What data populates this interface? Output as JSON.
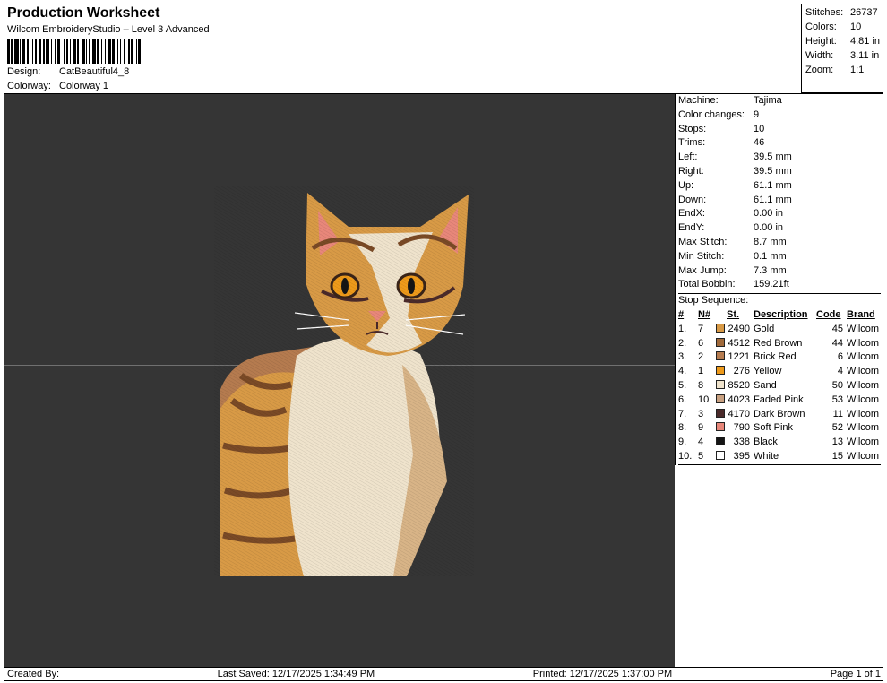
{
  "header": {
    "title": "Production Worksheet",
    "subtitle": "Wilcom EmbroideryStudio – Level 3 Advanced",
    "design_label": "Design:",
    "design_value": "CatBeautiful4_8",
    "colorway_label": "Colorway:",
    "colorway_value": "Colorway 1"
  },
  "stats": [
    {
      "label": "Stitches:",
      "value": "26737"
    },
    {
      "label": "Colors:",
      "value": "10"
    },
    {
      "label": "Height:",
      "value": "4.81 in"
    },
    {
      "label": "Width:",
      "value": "3.11 in"
    },
    {
      "label": "Zoom:",
      "value": "1:1"
    }
  ],
  "machine_info": [
    {
      "label": "Machine:",
      "value": "Tajima"
    },
    {
      "label": "Color changes:",
      "value": "9"
    },
    {
      "label": "Stops:",
      "value": "10"
    },
    {
      "label": "Trims:",
      "value": "46"
    },
    {
      "label": "Left:",
      "value": "39.5 mm"
    },
    {
      "label": "Right:",
      "value": "39.5 mm"
    },
    {
      "label": "Up:",
      "value": "61.1 mm"
    },
    {
      "label": "Down:",
      "value": "61.1 mm"
    },
    {
      "label": "EndX:",
      "value": "0.00 in"
    },
    {
      "label": "EndY:",
      "value": "0.00 in"
    },
    {
      "label": "Max Stitch:",
      "value": "8.7 mm"
    },
    {
      "label": "Min Stitch:",
      "value": "0.1 mm"
    },
    {
      "label": "Max Jump:",
      "value": "7.3 mm"
    },
    {
      "label": "Total Bobbin:",
      "value": "159.21ft"
    }
  ],
  "sequence": {
    "title": "Stop Sequence:",
    "headers": {
      "idx": "#",
      "needle": "N#",
      "st": "St.",
      "desc": "Description",
      "code": "Code",
      "brand": "Brand"
    },
    "rows": [
      {
        "idx": "1.",
        "needle": "7",
        "color": "#D89A46",
        "st": "2490",
        "desc": "Gold",
        "code": "45",
        "brand": "Wilcom"
      },
      {
        "idx": "2.",
        "needle": "6",
        "color": "#A0693A",
        "st": "4512",
        "desc": "Red Brown",
        "code": "44",
        "brand": "Wilcom"
      },
      {
        "idx": "3.",
        "needle": "2",
        "color": "#B57B4F",
        "st": "1221",
        "desc": "Brick Red",
        "code": "6",
        "brand": "Wilcom"
      },
      {
        "idx": "4.",
        "needle": "1",
        "color": "#EE9A1A",
        "st": "276",
        "desc": "Yellow",
        "code": "4",
        "brand": "Wilcom"
      },
      {
        "idx": "5.",
        "needle": "8",
        "color": "#EFE3CC",
        "st": "8520",
        "desc": "Sand",
        "code": "50",
        "brand": "Wilcom"
      },
      {
        "idx": "6.",
        "needle": "10",
        "color": "#C9A181",
        "st": "4023",
        "desc": "Faded Pink",
        "code": "53",
        "brand": "Wilcom"
      },
      {
        "idx": "7.",
        "needle": "3",
        "color": "#4A2A2A",
        "st": "4170",
        "desc": "Dark Brown",
        "code": "11",
        "brand": "Wilcom"
      },
      {
        "idx": "8.",
        "needle": "9",
        "color": "#E8877A",
        "st": "790",
        "desc": "Soft Pink",
        "code": "52",
        "brand": "Wilcom"
      },
      {
        "idx": "9.",
        "needle": "4",
        "color": "#151515",
        "st": "338",
        "desc": "Black",
        "code": "13",
        "brand": "Wilcom"
      },
      {
        "idx": "10.",
        "needle": "5",
        "color": "#FFFFFF",
        "st": "395",
        "desc": "White",
        "code": "15",
        "brand": "Wilcom"
      }
    ]
  },
  "footer": {
    "created": "Created By:",
    "saved": "Last Saved: 12/17/2025 1:34:49 PM",
    "printed": "Printed: 12/17/2025 1:37:00 PM",
    "page": "Page 1 of 1"
  },
  "colors": {
    "canvas": "#353535"
  }
}
